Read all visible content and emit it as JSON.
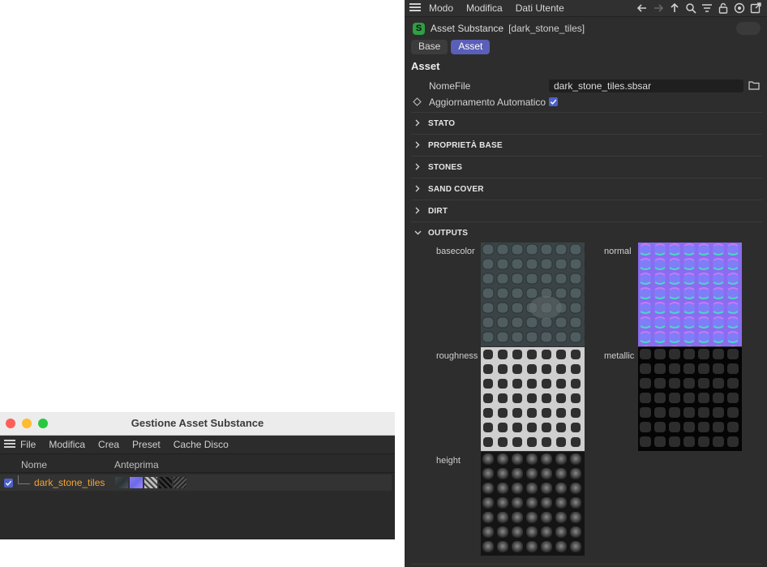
{
  "manager": {
    "title": "Gestione Asset Substance",
    "menu": [
      "File",
      "Modifica",
      "Crea",
      "Preset",
      "Cache Disco"
    ],
    "columns": {
      "name": "Nome",
      "preview": "Anteprima"
    },
    "rows": [
      {
        "name": "dark_stone_tiles",
        "checked": true
      }
    ],
    "traffic_colors": [
      "#fe5f57",
      "#febc2e",
      "#28c840"
    ]
  },
  "panel": {
    "menu": [
      "Modo",
      "Modifica",
      "Dati Utente"
    ],
    "toolbar_icons": [
      "arrow-left-icon",
      "arrow-right-icon",
      "arrow-up-icon",
      "search-icon",
      "filter-icon",
      "lock-icon",
      "target-icon",
      "new-window-icon"
    ],
    "object_type": "Asset Substance",
    "object_name": "[dark_stone_tiles]",
    "tabs": [
      "Base",
      "Asset"
    ],
    "active_tab": "Asset",
    "section": "Asset",
    "props": {
      "filename_label": "NomeFile",
      "filename_value": "dark_stone_tiles.sbsar",
      "auto_update_label": "Aggiornamento Automatico",
      "auto_update_checked": true
    },
    "groups": [
      "STATO",
      "PROPRIETÀ BASE",
      "STONES",
      "SAND COVER",
      "DIRT",
      "OUTPUTS"
    ],
    "outputs": [
      {
        "label": "basecolor"
      },
      {
        "label": "normal"
      },
      {
        "label": "roughness"
      },
      {
        "label": "metallic"
      },
      {
        "label": "height"
      }
    ],
    "accent": "#5a5fb7"
  }
}
